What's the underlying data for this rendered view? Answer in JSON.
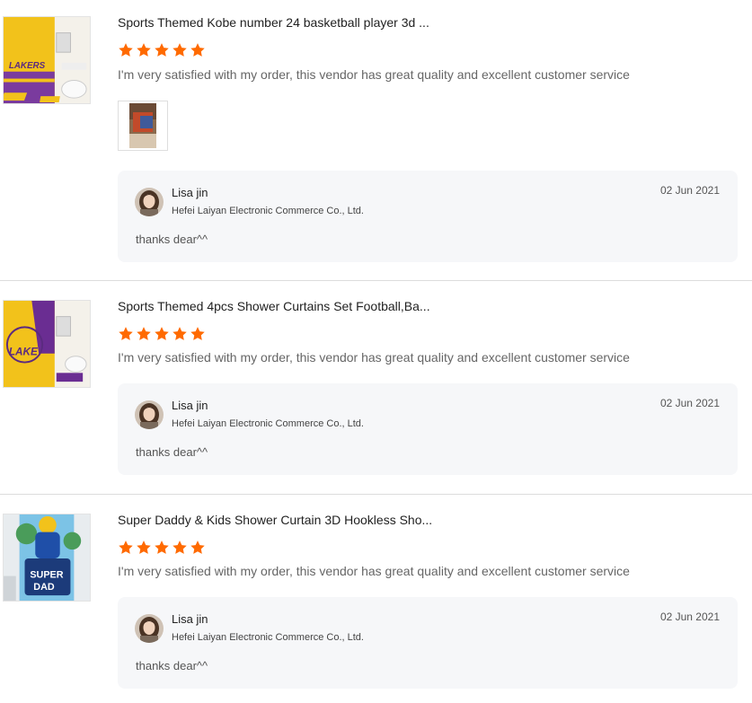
{
  "colors": {
    "star": "#ff6a00",
    "reply_bg": "#f6f7f9",
    "divider": "#dcdcdc"
  },
  "reviews": [
    {
      "product_title": "Sports Themed Kobe number 24 basketball player 3d ...",
      "rating": 5,
      "comment": "I'm very satisfied with my order, this vendor has great quality and excellent customer service",
      "reply": {
        "name": "Lisa jin",
        "company": "Hefei Laiyan Electronic Commerce Co., Ltd.",
        "date": "02 Jun 2021",
        "text": "thanks dear^^"
      }
    },
    {
      "product_title": "Sports Themed 4pcs Shower Curtains Set Football,Ba...",
      "rating": 5,
      "comment": "I'm very satisfied with my order, this vendor has great quality and excellent customer service",
      "reply": {
        "name": "Lisa jin",
        "company": "Hefei Laiyan Electronic Commerce Co., Ltd.",
        "date": "02 Jun 2021",
        "text": "thanks dear^^"
      }
    },
    {
      "product_title": "Super Daddy & Kids Shower Curtain 3D Hookless Sho...",
      "rating": 5,
      "comment": "I'm very satisfied with my order, this vendor has great quality and excellent customer service",
      "reply": {
        "name": "Lisa jin",
        "company": "Hefei Laiyan Electronic Commerce Co., Ltd.",
        "date": "02 Jun 2021",
        "text": "thanks dear^^"
      }
    }
  ]
}
